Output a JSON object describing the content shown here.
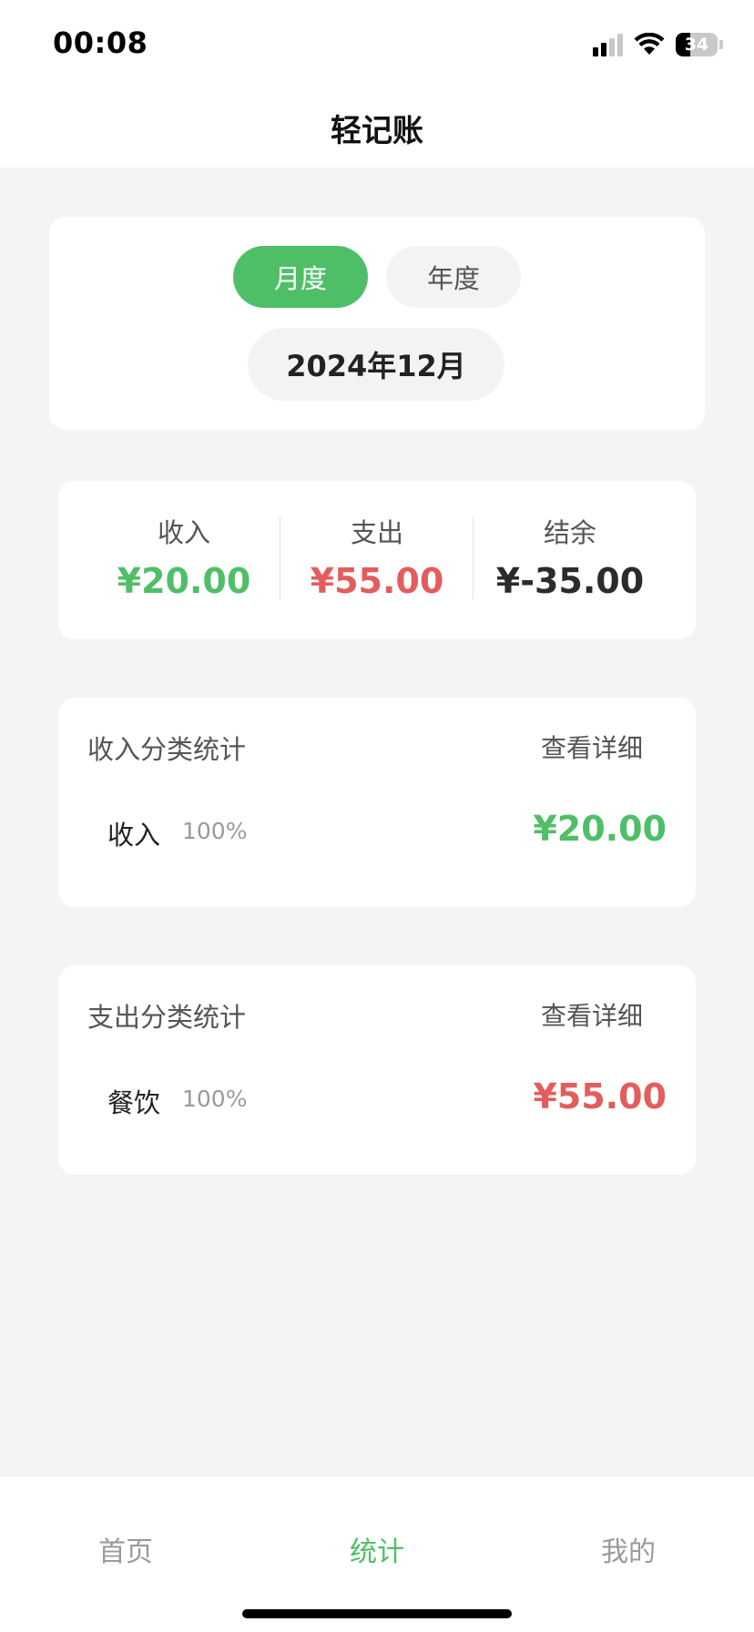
{
  "status_bar": {
    "time": "00:08",
    "battery_level": "34",
    "icons": [
      "signal-icon",
      "wifi-icon",
      "battery-icon"
    ]
  },
  "header": {
    "title": "轻记账"
  },
  "period": {
    "tabs": [
      {
        "label": "月度",
        "active": true
      },
      {
        "label": "年度",
        "active": false
      }
    ],
    "selected_date": "2024年12月"
  },
  "summary": {
    "income": {
      "label": "收入",
      "value": "¥20.00"
    },
    "expense": {
      "label": "支出",
      "value": "¥55.00"
    },
    "balance": {
      "label": "结余",
      "value": "¥-35.00"
    }
  },
  "income_categories": {
    "title": "收入分类统计",
    "link": "查看详细",
    "rows": [
      {
        "name": "收入",
        "percent": "100%",
        "amount": "¥20.00"
      }
    ]
  },
  "expense_categories": {
    "title": "支出分类统计",
    "link": "查看详细",
    "rows": [
      {
        "name": "餐饮",
        "percent": "100%",
        "amount": "¥55.00"
      }
    ]
  },
  "tabbar": {
    "items": [
      {
        "label": "首页",
        "active": false
      },
      {
        "label": "统计",
        "active": true
      },
      {
        "label": "我的",
        "active": false
      }
    ]
  },
  "colors": {
    "accent_green": "#4fbf67",
    "income_green": "#4fbf67",
    "expense_red": "#e35d5d",
    "balance_dark": "#2b2b2b",
    "inactive_tab": "#9a9a9a"
  }
}
